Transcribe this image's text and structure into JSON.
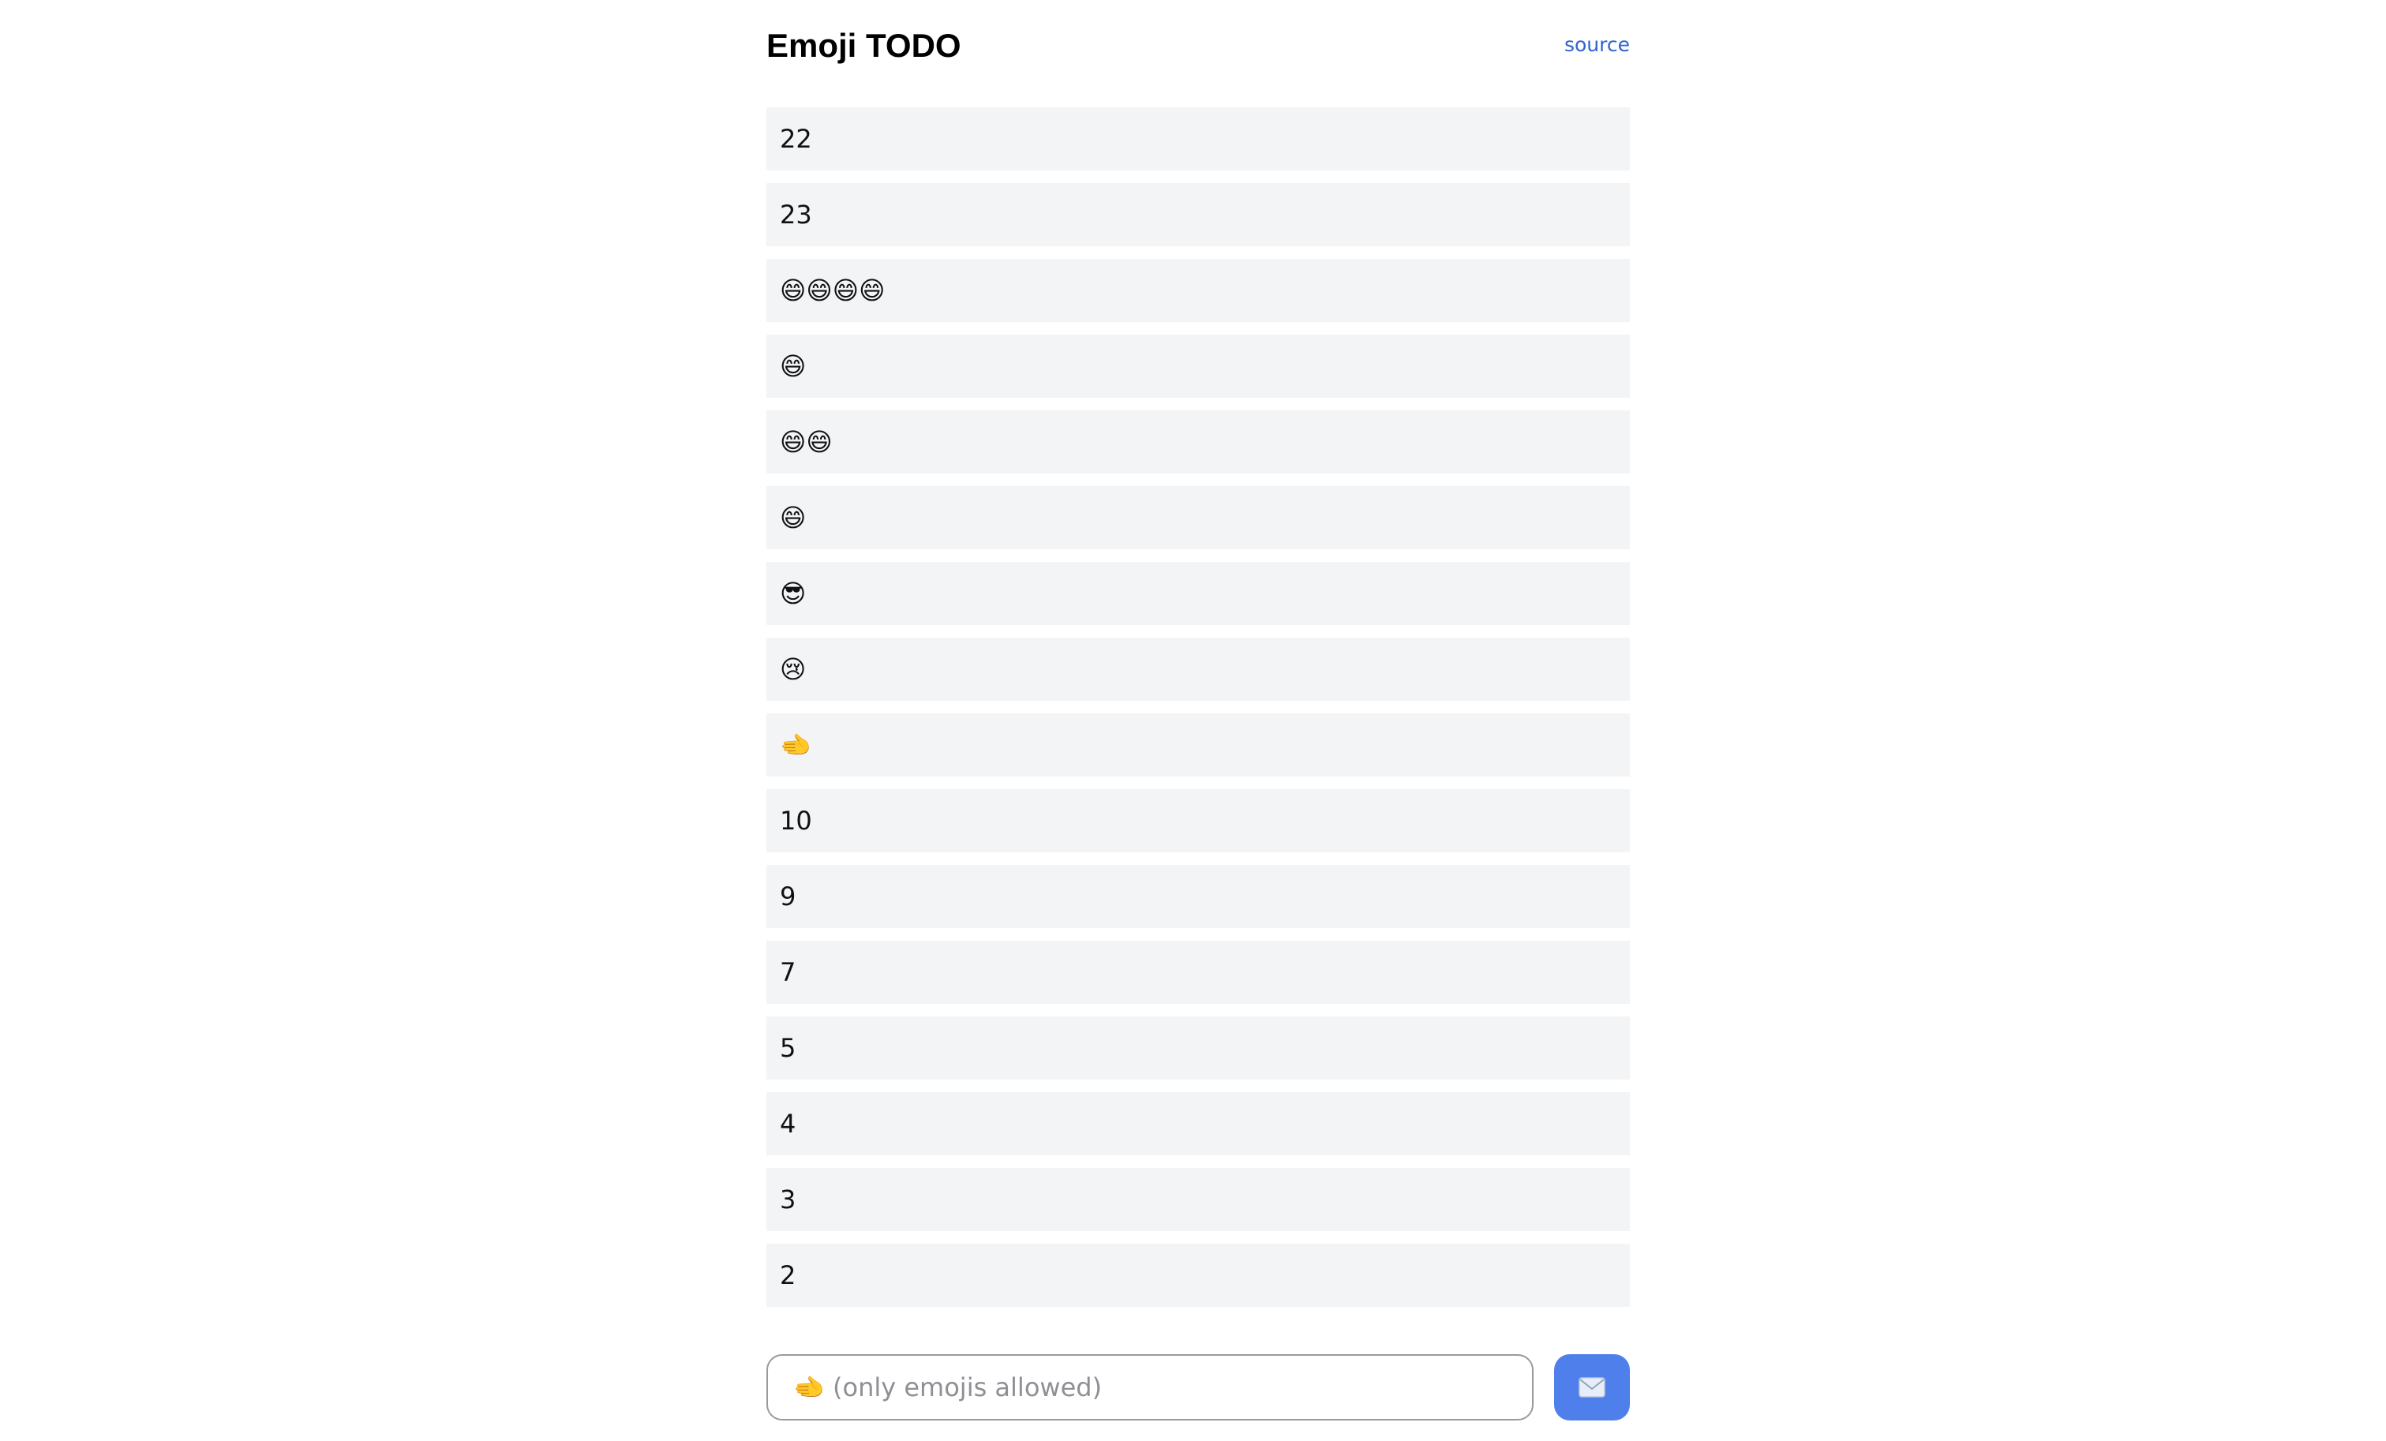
{
  "header": {
    "title": "Emoji TODO",
    "source_label": "source"
  },
  "todos": [
    {
      "text": "22"
    },
    {
      "text": "23"
    },
    {
      "text": "😄😄😄😄"
    },
    {
      "text": "😄"
    },
    {
      "text": "😄😄"
    },
    {
      "text": "😄"
    },
    {
      "text": "😎"
    },
    {
      "text": "😢"
    },
    {
      "text": "🫲"
    },
    {
      "text": "10"
    },
    {
      "text": "9"
    },
    {
      "text": "7"
    },
    {
      "text": "5"
    },
    {
      "text": "4"
    },
    {
      "text": "3"
    },
    {
      "text": "2"
    }
  ],
  "composer": {
    "placeholder": "🫲 (only emojis allowed)",
    "value": "",
    "send_icon": "envelope-icon"
  },
  "colors": {
    "accent": "#4f7fea",
    "link": "#2e63d1",
    "item_background": "#f3f4f6"
  }
}
